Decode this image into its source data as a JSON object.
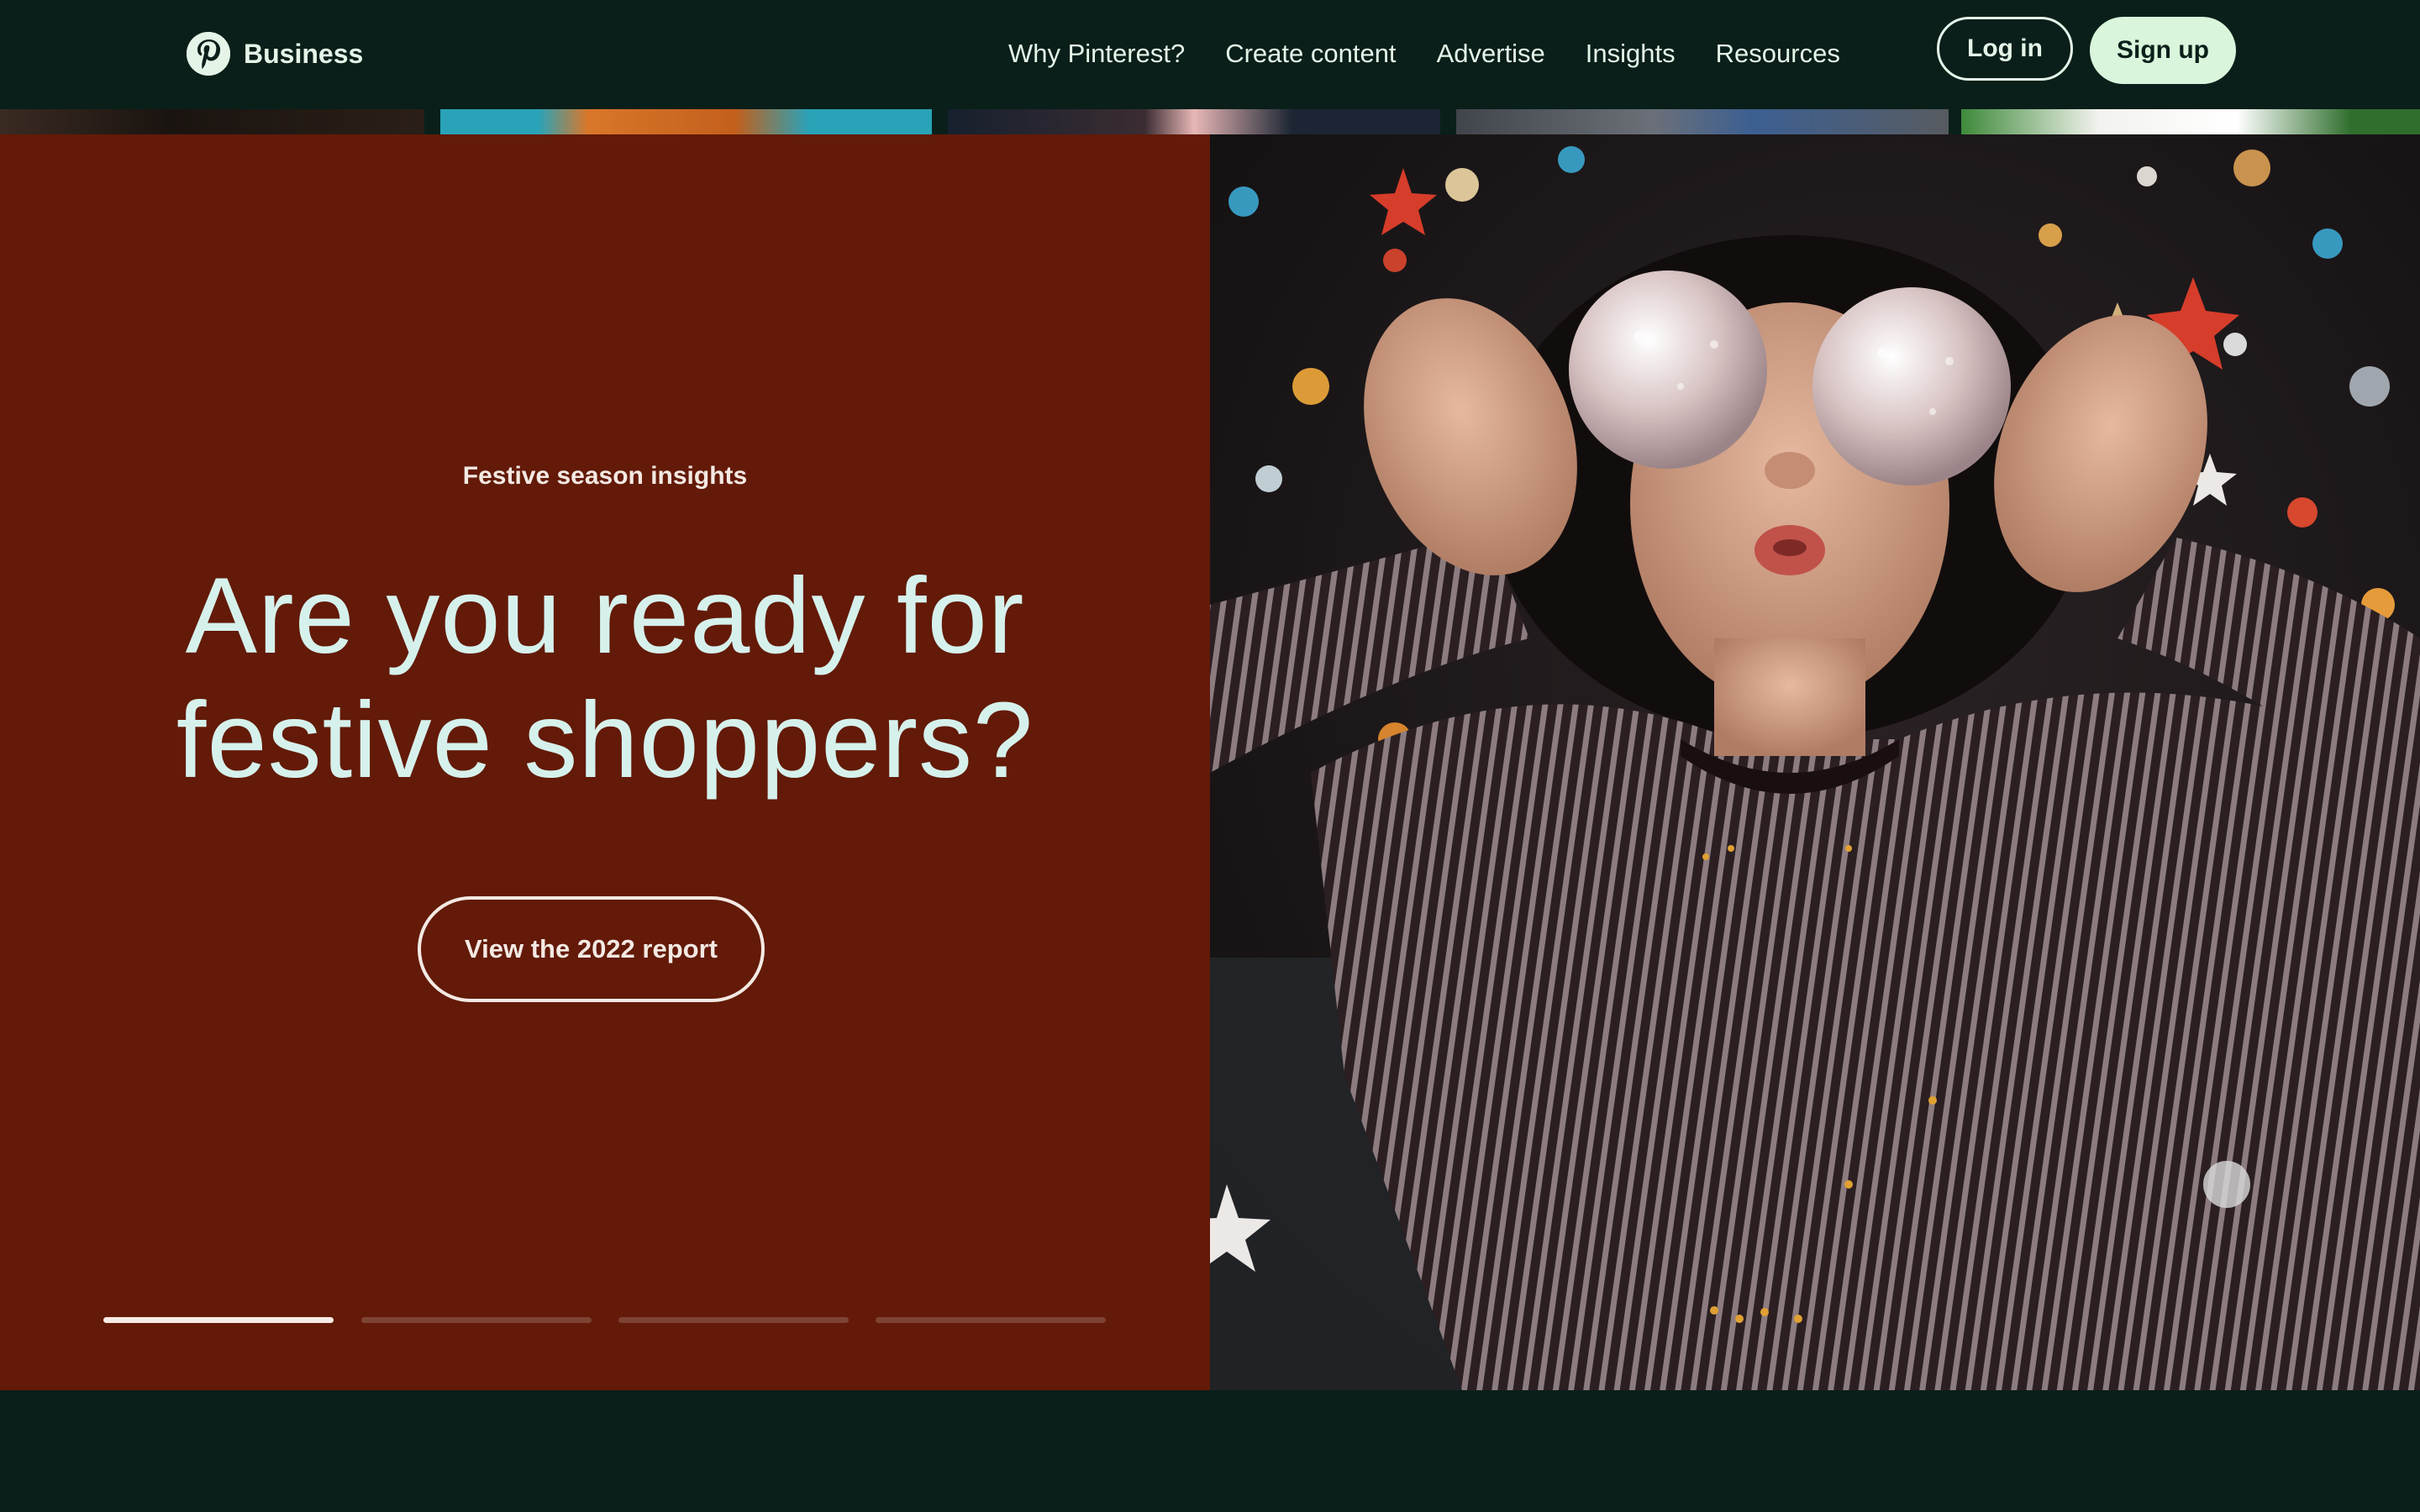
{
  "nav": {
    "brand": "Business",
    "logo_icon": "pinterest-logo-icon",
    "links": [
      "Why Pinterest?",
      "Create content",
      "Advertise",
      "Insights",
      "Resources"
    ],
    "login": "Log in",
    "signup": "Sign up"
  },
  "hero": {
    "eyebrow": "Festive season insights",
    "headline_line1": "Are you ready for",
    "headline_line2": "festive shoppers?",
    "cta": "View the 2022 report",
    "carousel": {
      "slides": 4,
      "active": 1
    }
  },
  "colors": {
    "nav_bg": "#0a1f1a",
    "hero_bg": "#631a08",
    "headline": "#d6f1ec",
    "accent_button": "#d9f5dc"
  }
}
